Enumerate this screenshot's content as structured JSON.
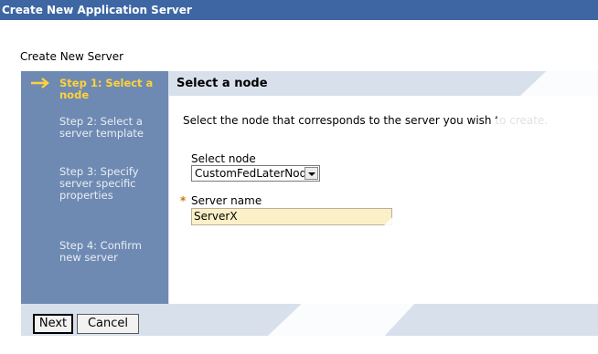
{
  "window": {
    "title": "Create New Application Server"
  },
  "page": {
    "section_title": "Create New Server"
  },
  "wizard": {
    "steps": [
      {
        "label": "Step 1: Select a node",
        "active": true
      },
      {
        "label": "Step 2: Select a server template",
        "active": false
      },
      {
        "label": "Step 3: Specify server specific properties",
        "active": false
      },
      {
        "label": "Step 4: Confirm new server",
        "active": false
      }
    ],
    "active_icon": "arrow-right-icon"
  },
  "content": {
    "header": "Select a node",
    "description": "Select the node that corresponds to the server you wish to create.",
    "select_node_label": "Select node",
    "select_node_value": "CustomFedLaterNode",
    "required_marker": "*",
    "server_name_label": "Server name",
    "server_name_value": "ServerX"
  },
  "buttons": {
    "next": "Next",
    "cancel": "Cancel"
  },
  "colors": {
    "titlebar": "#3d66a3",
    "steps_panel": "#6f8ab2",
    "active_step": "#ffd23a",
    "header_band": "#d8e0ec",
    "input_bg": "#fcf0c8"
  }
}
